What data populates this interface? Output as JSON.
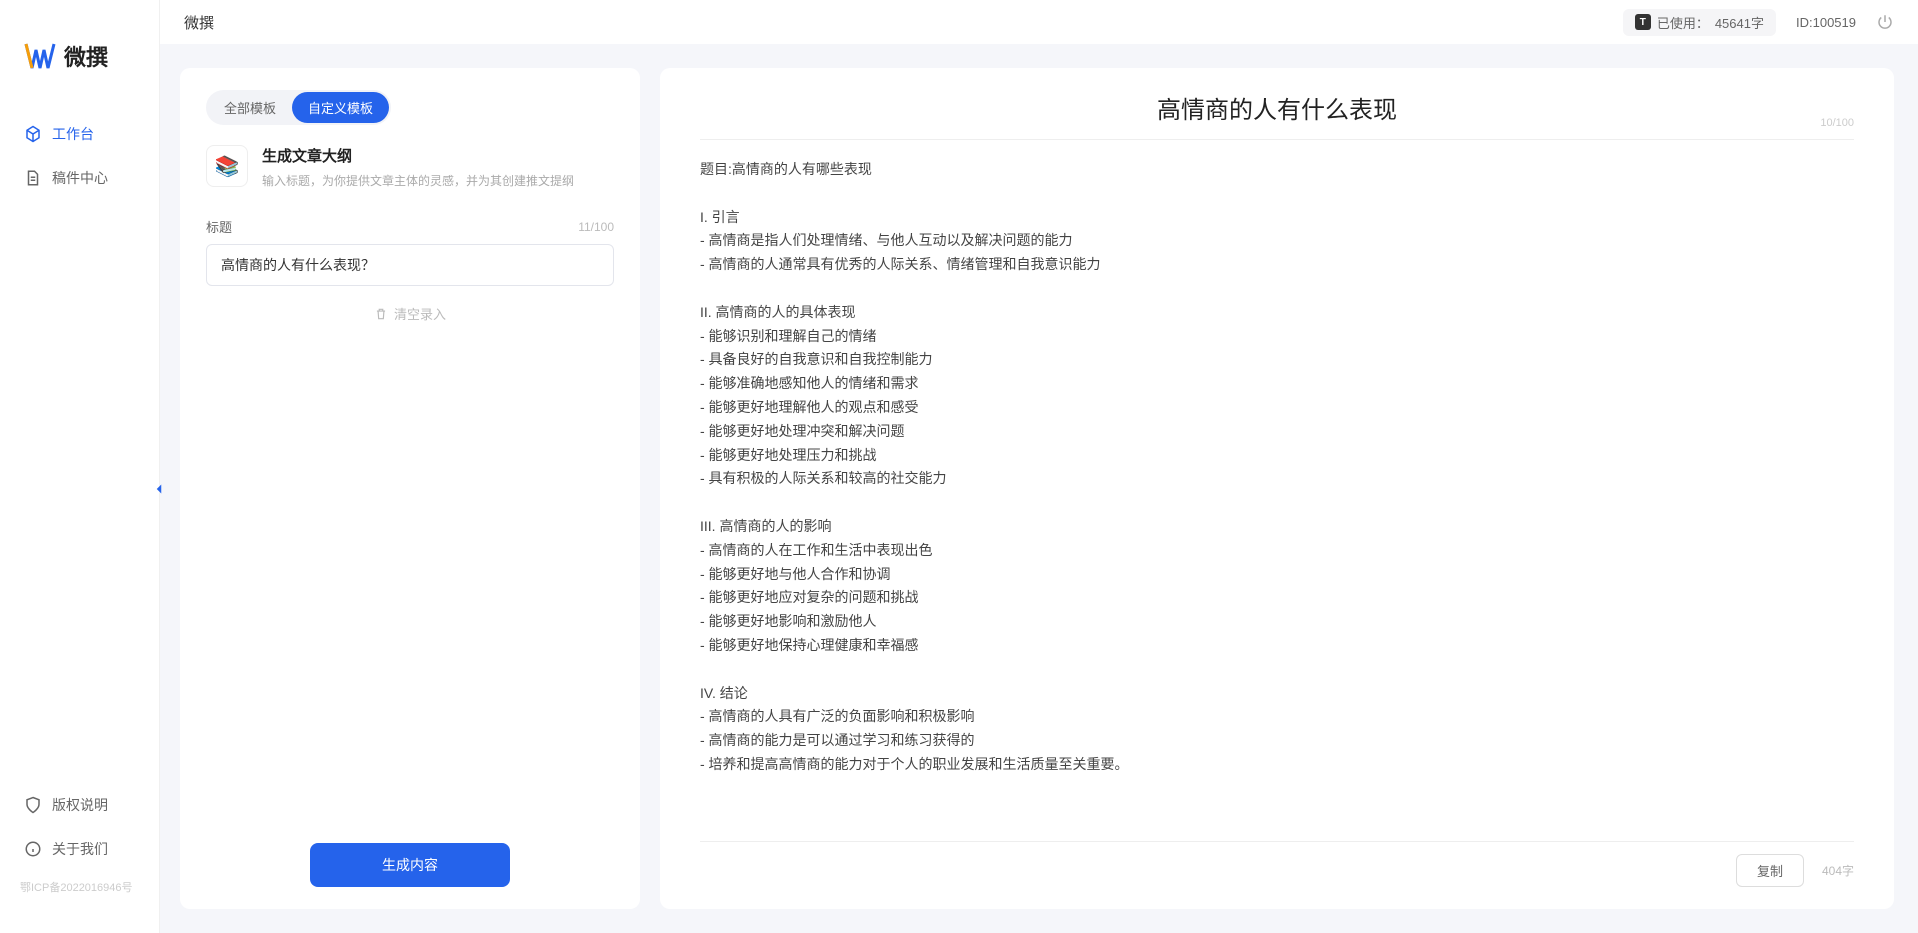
{
  "app_name": "微撰",
  "logo_text": "微撰",
  "nav": {
    "workspace": "工作台",
    "drafts": "稿件中心",
    "copyright": "版权说明",
    "about": "关于我们",
    "icp": "鄂ICP备2022016946号"
  },
  "topbar": {
    "usage_label": "已使用：",
    "usage_value": "45641字",
    "user_id_label": "ID:",
    "user_id": "100519"
  },
  "left": {
    "tabs": {
      "all": "全部模板",
      "custom": "自定义模板"
    },
    "template": {
      "icon": "📚",
      "title": "生成文章大纲",
      "desc": "输入标题，为你提供文章主体的灵感，并为其创建推文提纲"
    },
    "field_label": "标题",
    "field_counter": "11/100",
    "title_value": "高情商的人有什么表现？",
    "clear_label": "清空录入",
    "generate_label": "生成内容"
  },
  "right": {
    "title": "高情商的人有什么表现",
    "limit": "10/100",
    "body": "题目:高情商的人有哪些表现\n\nI. 引言\n- 高情商是指人们处理情绪、与他人互动以及解决问题的能力\n- 高情商的人通常具有优秀的人际关系、情绪管理和自我意识能力\n\nII. 高情商的人的具体表现\n- 能够识别和理解自己的情绪\n- 具备良好的自我意识和自我控制能力\n- 能够准确地感知他人的情绪和需求\n- 能够更好地理解他人的观点和感受\n- 能够更好地处理冲突和解决问题\n- 能够更好地处理压力和挑战\n- 具有积极的人际关系和较高的社交能力\n\nIII. 高情商的人的影响\n- 高情商的人在工作和生活中表现出色\n- 能够更好地与他人合作和协调\n- 能够更好地应对复杂的问题和挑战\n- 能够更好地影响和激励他人\n- 能够更好地保持心理健康和幸福感\n\nIV. 结论\n- 高情商的人具有广泛的负面影响和积极影响\n- 高情商的能力是可以通过学习和练习获得的\n- 培养和提高高情商的能力对于个人的职业发展和生活质量至关重要。",
    "copy_label": "复制",
    "word_count": "404字"
  }
}
